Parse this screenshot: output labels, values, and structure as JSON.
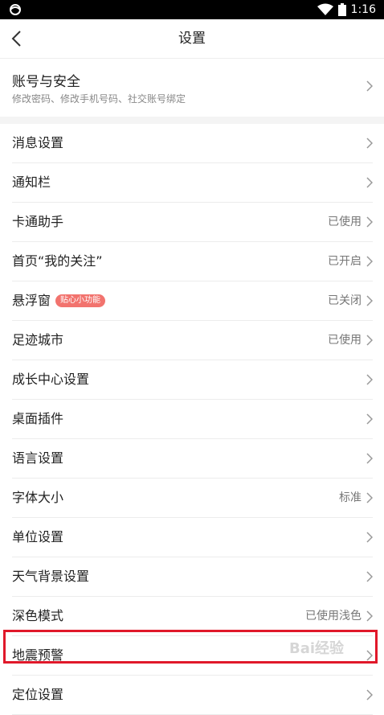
{
  "status_bar": {
    "time": "1:16",
    "app_icon": "app-logo-icon",
    "wifi_icon": "wifi-icon",
    "battery_icon": "battery-icon"
  },
  "header": {
    "title": "设置",
    "back_icon": "back-chevron-icon"
  },
  "account": {
    "title": "账号与安全",
    "subtitle": "修改密码、修改手机号码、社交账号绑定"
  },
  "settings": [
    {
      "label": "消息设置",
      "value": ""
    },
    {
      "label": "通知栏",
      "value": ""
    },
    {
      "label": "卡通助手",
      "value": "已使用"
    },
    {
      "label": "首页“我的关注”",
      "value": "已开启"
    },
    {
      "label": "悬浮窗",
      "badge": "贴心小功能",
      "value": "已关闭"
    },
    {
      "label": "足迹城市",
      "value": "已使用"
    },
    {
      "label": "成长中心设置",
      "value": ""
    },
    {
      "label": "桌面插件",
      "value": ""
    },
    {
      "label": "语言设置",
      "value": ""
    },
    {
      "label": "字体大小",
      "value": "标准"
    },
    {
      "label": "单位设置",
      "value": ""
    },
    {
      "label": "天气背景设置",
      "value": ""
    },
    {
      "label": "深色模式",
      "value": "已使用浅色"
    },
    {
      "label": "地震预警",
      "value": ""
    },
    {
      "label": "定位设置",
      "value": ""
    }
  ],
  "watermark": "Bai经验",
  "colors": {
    "highlight": "#e0182a",
    "badge": "#f2736e"
  }
}
